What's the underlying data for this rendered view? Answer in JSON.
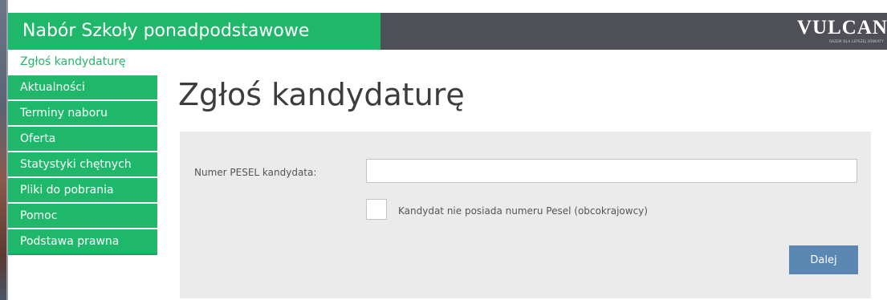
{
  "header": {
    "title": "Nabór Szkoły ponadpodstawowe",
    "logo_text": "VULCAN",
    "logo_tagline": "RAZEM DLA LEPSZEJ OŚWIATY"
  },
  "sidebar": {
    "items": [
      {
        "label": "Zgłoś kandydaturę",
        "active": true
      },
      {
        "label": "Aktualności"
      },
      {
        "label": "Terminy naboru"
      },
      {
        "label": "Oferta"
      },
      {
        "label": "Statystyki chętnych"
      },
      {
        "label": "Pliki do pobrania"
      },
      {
        "label": "Pomoc"
      },
      {
        "label": "Podstawa prawna"
      }
    ]
  },
  "main": {
    "title": "Zgłoś kandydaturę",
    "form": {
      "pesel_label": "Numer PESEL kandydata:",
      "pesel_value": "",
      "no_pesel_label": "Kandydat nie posiada numeru Pesel (obcokrajowcy)",
      "no_pesel_checked": false,
      "submit_label": "Dalej"
    }
  },
  "colors": {
    "accent": "#1fb86a",
    "header_dark": "#4f4f58",
    "button": "#5b87b3",
    "panel": "#ebebeb"
  }
}
